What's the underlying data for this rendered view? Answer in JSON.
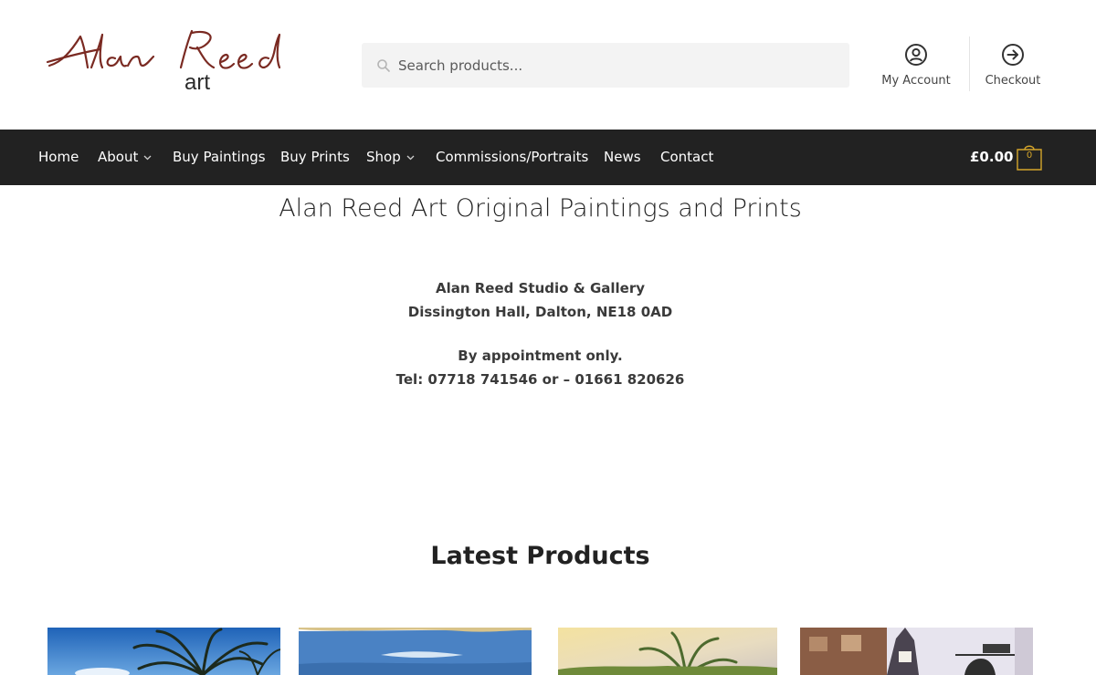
{
  "header": {
    "logo_script": "Alan Reed",
    "logo_sub": "art",
    "search": {
      "placeholder": "Search products..."
    },
    "account_label": "My Account",
    "checkout_label": "Checkout"
  },
  "nav": {
    "items": [
      {
        "label": "Home",
        "has_dropdown": false
      },
      {
        "label": "About",
        "has_dropdown": true
      },
      {
        "label": "Buy Paintings",
        "has_dropdown": false
      },
      {
        "label": "Buy Prints",
        "has_dropdown": false
      },
      {
        "label": "Shop",
        "has_dropdown": true
      },
      {
        "label": "Commissions/Portraits",
        "has_dropdown": false
      },
      {
        "label": "News",
        "has_dropdown": false
      },
      {
        "label": "Contact",
        "has_dropdown": false
      }
    ],
    "cart_total": "£0.00",
    "cart_count": "0"
  },
  "main": {
    "title": "Alan Reed Art Original Paintings and Prints",
    "studio_name": "Alan Reed Studio & Gallery",
    "address": "Dissington Hall, Dalton, NE18 0AD",
    "appointment": "By appointment only.",
    "phone": "Tel: 07718 741546 or – 01661 820626",
    "latest_title": "Latest Products"
  },
  "colors": {
    "nav_bg": "#222222",
    "accent": "#d4a52a",
    "logo": "#7a2a22"
  },
  "icons": [
    "search-icon",
    "account-icon",
    "checkout-icon",
    "chevron-down-icon",
    "cart-icon"
  ]
}
